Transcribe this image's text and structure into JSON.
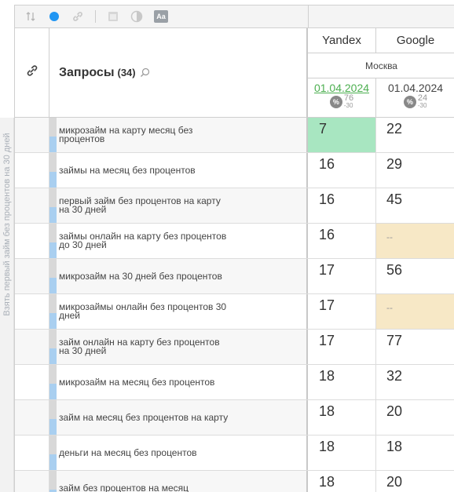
{
  "sidebar": {
    "vertical_text": "Взять первый займ без процентов на 30 дней"
  },
  "toolbar": {
    "icons": [
      "sort-icon",
      "dot-icon",
      "link-icon",
      "calendar-icon",
      "contrast-icon",
      "font-icon"
    ],
    "font_icon_label": "Aa",
    "accent_color": "#2196f3"
  },
  "header": {
    "title": "Запросы",
    "count": "(34)",
    "engines": {
      "yandex": "Yandex",
      "google": "Google"
    },
    "region": "Москва",
    "yandex_date": "01.04.2024",
    "yandex_stat": {
      "value": "76",
      "delta": "-30"
    },
    "google_date": "01.04.2024",
    "google_stat": {
      "value": "24",
      "delta": "-30"
    },
    "pct_badge": "%"
  },
  "rows": [
    {
      "query": "микрозайм на карту месяц без процентов",
      "yandex": "7",
      "google": "22",
      "y_hl": "green",
      "g_hl": ""
    },
    {
      "query": "займы на месяц без процентов",
      "yandex": "16",
      "google": "29",
      "y_hl": "",
      "g_hl": ""
    },
    {
      "query": "первый займ без процентов на карту на 30 дней",
      "yandex": "16",
      "google": "45",
      "y_hl": "",
      "g_hl": ""
    },
    {
      "query": "займы онлайн на карту без процентов до 30 дней",
      "yandex": "16",
      "google": "--",
      "y_hl": "",
      "g_hl": "beige"
    },
    {
      "query": "микрозайм на 30 дней без процентов",
      "yandex": "17",
      "google": "56",
      "y_hl": "",
      "g_hl": ""
    },
    {
      "query": "микрозаймы онлайн без процентов 30 дней",
      "yandex": "17",
      "google": "--",
      "y_hl": "",
      "g_hl": "beige"
    },
    {
      "query": "займ онлайн на карту без процентов на 30 дней",
      "yandex": "17",
      "google": "77",
      "y_hl": "",
      "g_hl": ""
    },
    {
      "query": "микрозайм на месяц без процентов",
      "yandex": "18",
      "google": "32",
      "y_hl": "",
      "g_hl": ""
    },
    {
      "query": "займ на месяц без процентов на карту",
      "yandex": "18",
      "google": "20",
      "y_hl": "",
      "g_hl": ""
    },
    {
      "query": "деньги на месяц без процентов",
      "yandex": "18",
      "google": "18",
      "y_hl": "",
      "g_hl": ""
    },
    {
      "query": "займ без процентов на месяц",
      "yandex": "18",
      "google": "20",
      "y_hl": "",
      "g_hl": ""
    }
  ]
}
